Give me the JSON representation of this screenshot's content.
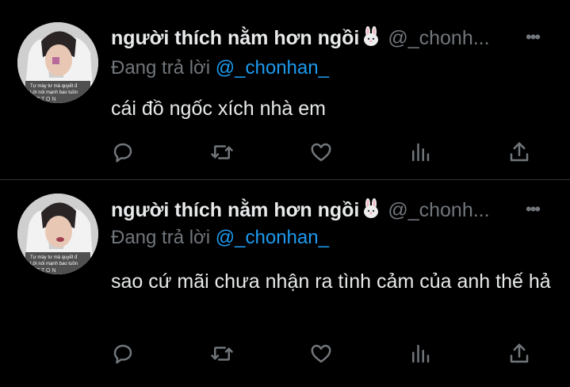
{
  "tweets": [
    {
      "display_name": "người thích nằm hơn ngồi",
      "handle": "@_chonh...",
      "replying_prefix": "Đang trả lời",
      "replying_to": "@_chonhan_",
      "text": "cái đồ ngốc xích nhà em",
      "avatar_caption_1": "Tự mày tư mà quyết đ",
      "avatar_caption_2": "Lời nói mạnh bao tuồn",
      "avatar_caption_3": "T T O N"
    },
    {
      "display_name": "người thích nằm hơn ngồi",
      "handle": "@_chonh...",
      "replying_prefix": "Đang trả lời",
      "replying_to": "@_chonhan_",
      "text": "sao cứ mãi chưa nhận ra tình cảm của anh thế hả",
      "avatar_caption_1": "Tự mày tư mà quyết đ",
      "avatar_caption_2": "Lời nói mạnh bao tuồn",
      "avatar_caption_3": "T T O N"
    }
  ],
  "more_glyph": "•••",
  "icons": [
    "reply-icon",
    "retweet-icon",
    "like-icon",
    "views-icon",
    "share-icon"
  ],
  "colors": {
    "background": "#000000",
    "text": "#e7e9ea",
    "secondary": "#71767b",
    "accent": "#1d9bf0"
  }
}
